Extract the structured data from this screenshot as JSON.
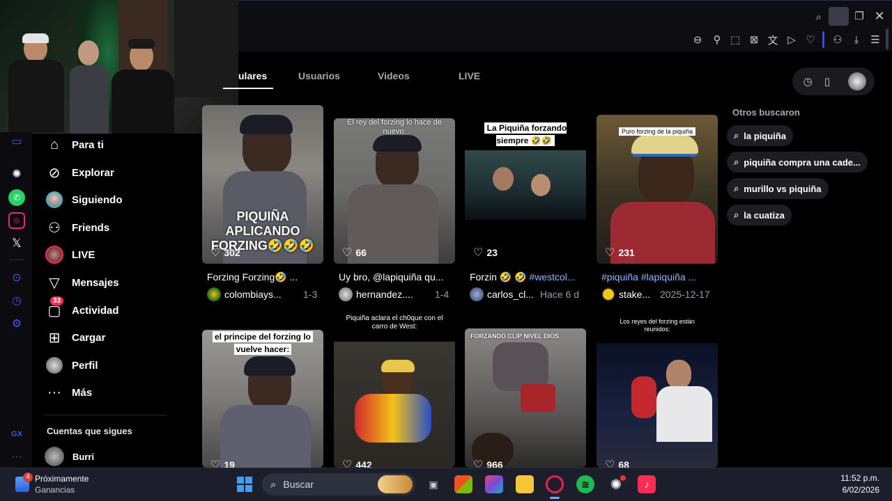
{
  "tabs": [
    {
      "label": "ulares"
    },
    {
      "label": "Usuarios"
    },
    {
      "label": "Videos"
    },
    {
      "label": "LIVE"
    }
  ],
  "nav": [
    {
      "label": "Para ti",
      "icon": "home-icon"
    },
    {
      "label": "Explorar",
      "icon": "compass-icon"
    },
    {
      "label": "Siguiendo",
      "icon": "following-avatar-icon"
    },
    {
      "label": "Friends",
      "icon": "friends-icon"
    },
    {
      "label": "LIVE",
      "icon": "live-icon"
    },
    {
      "label": "Mensajes",
      "icon": "send-icon"
    },
    {
      "label": "Actividad",
      "icon": "activity-icon",
      "badge": "33"
    },
    {
      "label": "Cargar",
      "icon": "upload-icon"
    },
    {
      "label": "Perfil",
      "icon": "profile-icon"
    },
    {
      "label": "Más",
      "icon": "more-icon"
    }
  ],
  "following": {
    "heading": "Cuentas que sigues",
    "accounts": [
      {
        "name": "Burri"
      }
    ]
  },
  "videos": [
    {
      "overlay": "PIQUIÑA APLICANDO FORZING🤣🤣🤣",
      "likes": "302",
      "title": "Forzing Forzing🤣 ...",
      "author": "colombiays...",
      "date": "1-3"
    },
    {
      "overlay": "El rey del forzing lo hace de nuevo:",
      "likes": "66",
      "title": "Uy bro, @lapiquiña qu...",
      "author": "hernandez....",
      "date": "1-4"
    },
    {
      "overlay": "La Piquiña forzando siempre 🤣🤣",
      "likes": "23",
      "title": "Forzin 🤣 🤣 ",
      "title_tag": "#westcol...",
      "author": "carlos_cl...",
      "date": "Hace 6 d"
    },
    {
      "overlay": "Puro forzing de la piquiña",
      "likes": "231",
      "title": "",
      "title_tag": "#piquiña #lapiquiña ...",
      "author": "stake...",
      "date": "2025-12-17"
    },
    {
      "overlay": "el principe del forzing lo vuelve hacer:",
      "likes": "19"
    },
    {
      "overlay": "Piquiña aclara el ch0que con el carro de West:",
      "likes": "442"
    },
    {
      "overlay": "FORZANDO CLIP NIVEL DIOS",
      "likes": "966"
    },
    {
      "overlay": "Los reyes del forzing están reunidos:",
      "likes": "68"
    }
  ],
  "others": {
    "heading": "Otros buscaron",
    "items": [
      "la piquiña",
      "piquiña compra una cade...",
      "murillo vs piquiña",
      "la cuatiza"
    ]
  },
  "taskbar": {
    "notice_badge": "4",
    "notice_title": "Próximamente",
    "notice_sub": "Ganancias",
    "search_placeholder": "Buscar",
    "time": "11:52 p.m.",
    "date": "6/02/2026"
  },
  "sidebar_gx": "GX",
  "accent": "#fe2c55"
}
